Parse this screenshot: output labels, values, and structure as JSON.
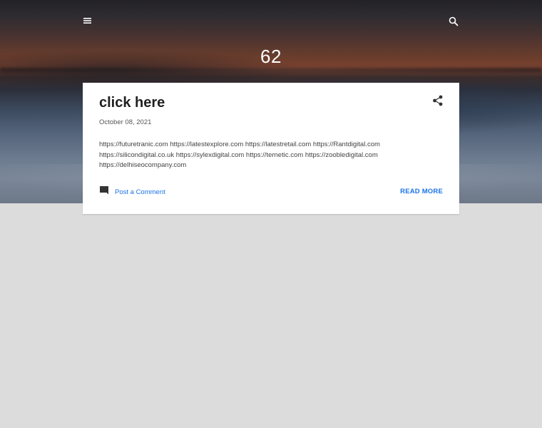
{
  "header": {
    "menu_icon": "hamburger-menu-icon",
    "search_icon": "search-icon",
    "blog_title": "62"
  },
  "post": {
    "title": "click here",
    "date": "October 08, 2021",
    "body": "https://futuretranic.com https://latestexplore.com https://latestretail.com https://Rantdigital.com https://silicondigital.co.uk https://sylexdigital.com https://ternetic.com https://zoobledigital.com https://delhiseocompany.com",
    "share_icon": "share-icon",
    "comment_icon": "comment-icon",
    "comment_label": "Post a Comment",
    "read_more_label": "READ MORE"
  },
  "colors": {
    "link": "#1a73e8",
    "page_background": "#dcdcdc",
    "card_background": "#ffffff"
  }
}
